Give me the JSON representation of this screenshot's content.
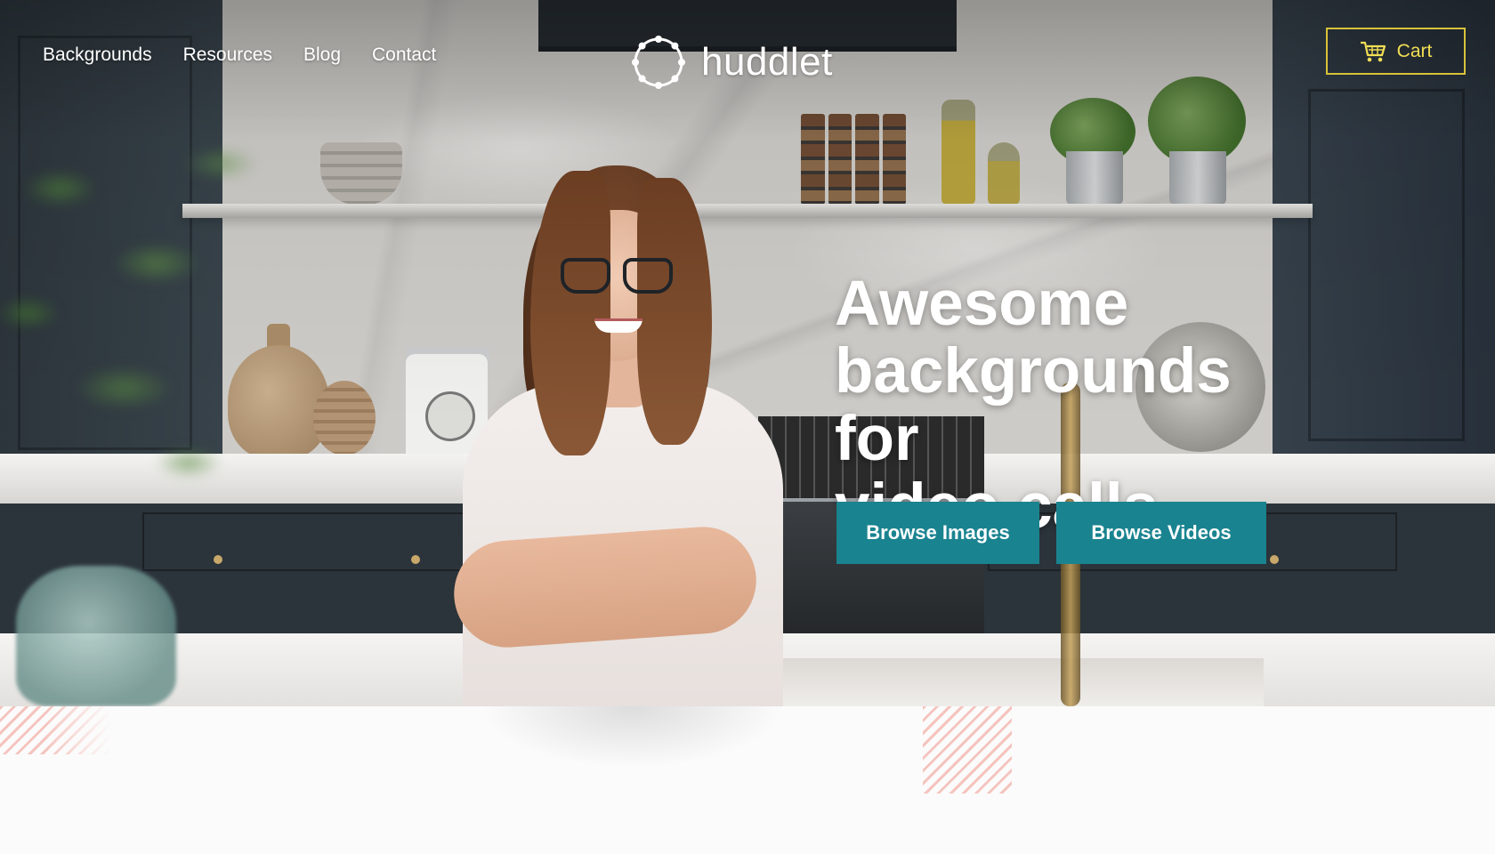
{
  "nav": {
    "items": [
      {
        "label": "Backgrounds"
      },
      {
        "label": "Resources"
      },
      {
        "label": "Blog"
      },
      {
        "label": "Contact"
      }
    ]
  },
  "logo": {
    "text": "huddlet",
    "icon": "ring-of-dots-icon"
  },
  "cart": {
    "label": "Cart",
    "icon": "shopping-cart-icon",
    "color": "#d8c23a"
  },
  "hero": {
    "headline_line1": "Awesome",
    "headline_line2": "backgrounds for",
    "headline_line3": "video calls",
    "buttons": {
      "browse_images": "Browse Images",
      "browse_videos": "Browse Videos"
    },
    "button_color": "#1a8390"
  }
}
